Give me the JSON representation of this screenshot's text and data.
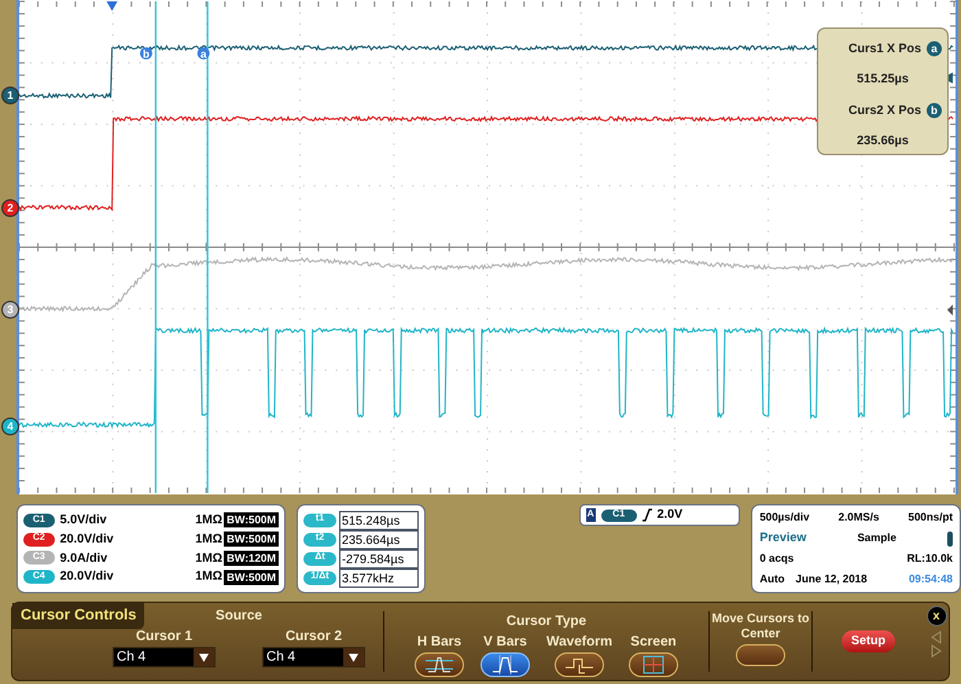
{
  "channel_markers": [
    {
      "label": "1",
      "color": "#1b5f73"
    },
    {
      "label": "2",
      "color": "#e02020"
    },
    {
      "label": "3",
      "color": "#b4b4b4"
    },
    {
      "label": "4",
      "color": "#1fb5c8"
    }
  ],
  "cursor_markers": [
    {
      "label": "b"
    },
    {
      "label": "a"
    }
  ],
  "cursor_readout": [
    {
      "label": "Curs1 X Pos",
      "badge": "a",
      "value": "515.25µs"
    },
    {
      "label": "Curs2 X Pos",
      "badge": "b",
      "value": "235.66µs"
    }
  ],
  "channels": [
    {
      "badge": "C1",
      "color": "#1b5f73",
      "scale": "5.0V/div",
      "impedance": "1MΩ",
      "bandwidth": "BW:500M"
    },
    {
      "badge": "C2",
      "color": "#e02020",
      "scale": "20.0V/div",
      "impedance": "1MΩ",
      "bandwidth": "BW:500M"
    },
    {
      "badge": "C3",
      "color": "#b4b4b4",
      "scale": "9.0A/div",
      "impedance": "1MΩ",
      "bandwidth": "BW:120M"
    },
    {
      "badge": "C4",
      "color": "#1fb5c8",
      "scale": "20.0V/div",
      "impedance": "1MΩ",
      "bandwidth": "BW:500M"
    }
  ],
  "measurements": [
    {
      "badge": "t1",
      "value": "515.248µs"
    },
    {
      "badge": "t2",
      "value": "235.664µs"
    },
    {
      "badge": "Δt",
      "value": "-279.584µs"
    },
    {
      "badge": "1/Δt",
      "value": "3.577kHz"
    }
  ],
  "trigger": {
    "mode": "A",
    "source": "C1",
    "level": "2.0V"
  },
  "acquisition": {
    "timebase": "500µs/div",
    "sample_rate": "2.0MS/s",
    "resolution": "500ns/pt",
    "state": "Preview",
    "mode": "Sample",
    "acqs": "0 acqs",
    "record_length": "RL:10.0k",
    "trigger_mode": "Auto",
    "date": "June 12, 2018",
    "time": "09:54:48"
  },
  "cursor_controls": {
    "title": "Cursor Controls",
    "source_label": "Source",
    "sources": [
      {
        "label": "Cursor 1",
        "value": "Ch 4"
      },
      {
        "label": "Cursor 2",
        "value": "Ch 4"
      }
    ],
    "type_label": "Cursor Type",
    "types": [
      {
        "label": "H Bars",
        "kind": "hbars",
        "selected": false
      },
      {
        "label": "V Bars",
        "kind": "vbars",
        "selected": true
      },
      {
        "label": "Waveform",
        "kind": "waveform",
        "selected": false
      },
      {
        "label": "Screen",
        "kind": "screen",
        "selected": false
      }
    ],
    "center_button": "Move Cursors to Center",
    "setup_button": "Setup",
    "close": "x"
  }
}
